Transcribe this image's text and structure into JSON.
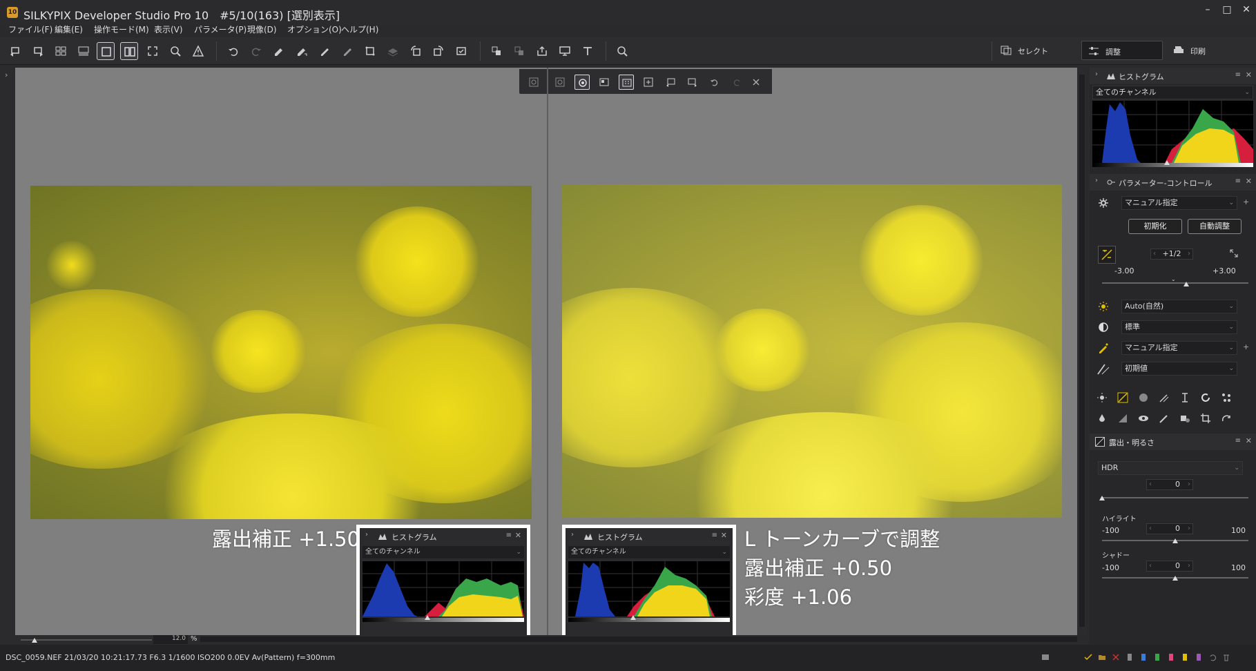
{
  "app": {
    "icon_label": "10",
    "title": "SILKYPIX Developer Studio Pro 10　#5/10(163) [選別表示]"
  },
  "menu": [
    "ファイル(F)",
    "編集(E)",
    "操作モード(M)",
    "表示(V)",
    "パラメータ(P)",
    "現像(D)",
    "オプション(O)",
    "ヘルプ(H)"
  ],
  "modes": {
    "select": "セレクト",
    "adjust": "調整",
    "print": "印刷"
  },
  "captions": {
    "left": "露出補正 +1.50",
    "right_line1": "L トーンカーブで調整",
    "right_line2": "露出補正 +0.50",
    "right_line3": "彩度 +1.06"
  },
  "histogram": {
    "title": "ヒストグラム",
    "channel": "全てのチャンネル",
    "channel_colors": {
      "blue": "#1d3bb0",
      "red": "#d61f3c",
      "yellow": "#f0d51a",
      "green": "#3aa64a"
    }
  },
  "zoom": {
    "value": "12.0",
    "unit": "%"
  },
  "panel": {
    "histogram_title": "ヒストグラム",
    "histogram_channel": "全てのチャンネル",
    "param_title": "パラメーター-コントロール",
    "taste": "マニュアル指定",
    "reset_button": "初期化",
    "auto_button": "自動調整",
    "exposure": {
      "step": "+1/2",
      "min": "-3.00",
      "max": "+3.00"
    },
    "white_balance": "Auto(自然)",
    "tone": "標準",
    "color": "マニュアル指定",
    "sharpness": "初期値",
    "exposure_section": {
      "title": "露出・明るさ",
      "mode": "HDR",
      "hdr_value": "0",
      "highlight": {
        "label": "ハイライト",
        "min": "-100",
        "max": "100",
        "value": "0"
      },
      "shadow": {
        "label": "シャドー",
        "min": "-100",
        "max": "100",
        "value": "0"
      }
    }
  },
  "status": {
    "text": "DSC_0059.NEF 21/03/20 10:21:17.73 F6.3 1/1600 ISO200  0.0EV Av(Pattern) f=300mm"
  }
}
